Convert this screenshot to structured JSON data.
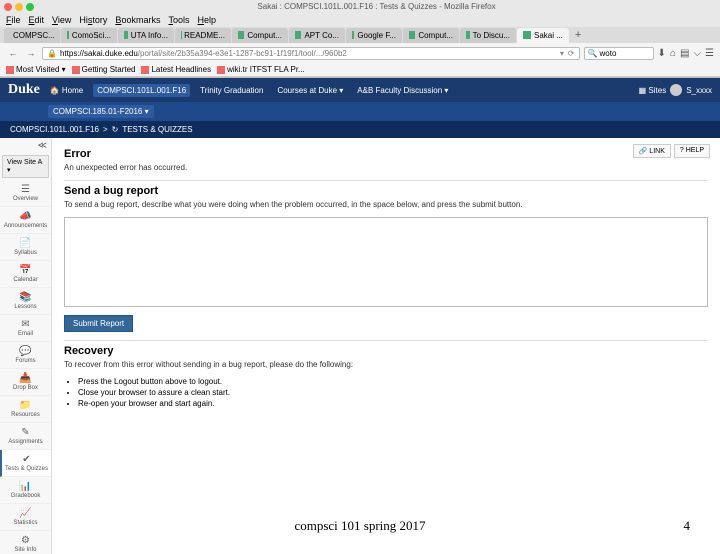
{
  "window": {
    "title": "Sakai : COMPSCI.101L.001.F16 : Tests & Quizzes - Mozilla Firefox"
  },
  "menubar": [
    "File",
    "Edit",
    "View",
    "History",
    "Bookmarks",
    "Tools",
    "Help"
  ],
  "tabs": [
    {
      "label": "COMPSC..."
    },
    {
      "label": "ComoSci..."
    },
    {
      "label": "UTA Info..."
    },
    {
      "label": "README..."
    },
    {
      "label": "Comput..."
    },
    {
      "label": "APT Co..."
    },
    {
      "label": "Google F..."
    },
    {
      "label": "Comput..."
    },
    {
      "label": "To Discu..."
    },
    {
      "label": "Sakai ..."
    }
  ],
  "url": {
    "host": "https://sakai.duke.edu",
    "path": "/portal/site/2b35a394-e3e1-1287-bc91-1f19f1/tool/.../960b2",
    "search_placeholder": "woto"
  },
  "bookmarks": [
    "Most Visited ▾",
    "Getting Started",
    "Latest Headlines",
    "wiki.tr ITFST FLA Pr..."
  ],
  "sakai_header": {
    "logo": "Duke",
    "home": "Home",
    "course_active": "COMPSCI.101L.001.F16",
    "nav_items": [
      "Trinity Graduation",
      "Courses at Duke ▾",
      "A&B Faculty Discussion ▾"
    ],
    "sites": "Sites",
    "user_menu": "S_xxxx"
  },
  "sakai_subheader": {
    "tab": "COMPSCI.185.01-F2016 ▾"
  },
  "breadcrumb": {
    "course": "COMPSCI.101L.001.F16",
    "sep": ">",
    "icon": "↻",
    "tool": "TESTS & QUIZZES"
  },
  "sidebar": {
    "collapse": "≪",
    "view_site": "View Site A ▾",
    "items": [
      {
        "icon": "☰",
        "label": "Overview"
      },
      {
        "icon": "📣",
        "label": "Announcements"
      },
      {
        "icon": "📄",
        "label": "Syllabus"
      },
      {
        "icon": "📅",
        "label": "Calendar"
      },
      {
        "icon": "📚",
        "label": "Lessons"
      },
      {
        "icon": "✉",
        "label": "Email"
      },
      {
        "icon": "💬",
        "label": "Forums"
      },
      {
        "icon": "📥",
        "label": "Drop Box"
      },
      {
        "icon": "📁",
        "label": "Resources"
      },
      {
        "icon": "✎",
        "label": "Assignments"
      },
      {
        "icon": "✔",
        "label": "Tests & Quizzes"
      },
      {
        "icon": "📊",
        "label": "Gradebook"
      },
      {
        "icon": "📈",
        "label": "Statistics"
      },
      {
        "icon": "⚙",
        "label": "Site Info"
      }
    ]
  },
  "content": {
    "link_btn": "🔗 LINK",
    "help_btn": "? HELP",
    "error_heading": "Error",
    "error_text": "An unexpected error has occurred.",
    "bug_heading": "Send a bug report",
    "bug_text": "To send a bug report, describe what you were doing when the problem occurred, in the space below, and press the submit button.",
    "submit_label": "Submit Report",
    "recovery_heading": "Recovery",
    "recovery_text": "To recover from this error without sending in a bug report, please do the following:",
    "recovery_steps": [
      "Press the Logout button above to logout.",
      "Close your browser to assure a clean start.",
      "Re-open your browser and start again."
    ]
  },
  "footer": {
    "text": "compsci 101 spring 2017",
    "page": "4"
  }
}
